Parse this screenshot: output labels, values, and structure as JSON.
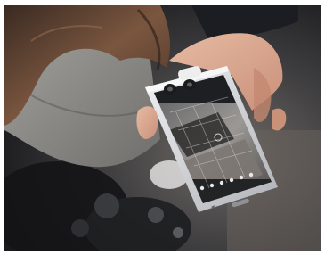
{
  "photo": {
    "subject": "",
    "phone_screen": {
      "camera_app": true,
      "grid_overlay": true,
      "toolbar_icon_count": 6
    }
  },
  "colors": {
    "background_dark": "#1e1f22",
    "coat_gray": "#8a8a86",
    "hair_brown": "#6b4a36",
    "skin": "#d9a98f",
    "phone_silver": "#d7d9dc",
    "screen_dark": "#2b2d30",
    "frame_border": "#ffffff"
  }
}
